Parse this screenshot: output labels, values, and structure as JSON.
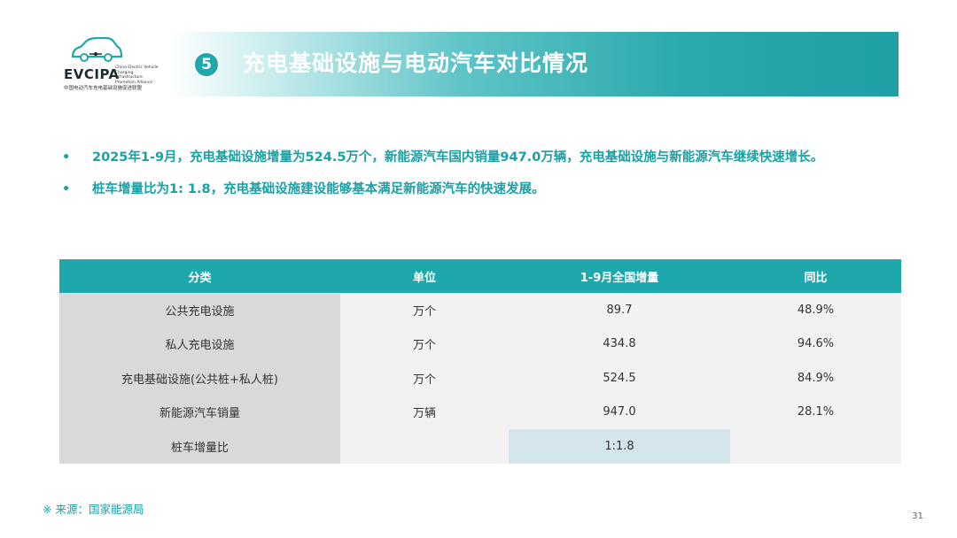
{
  "logo": {
    "brand": "EVCIPA",
    "english_lines": [
      "China Electric Vehicle",
      "Charging Infrastructure",
      "Promotion Alliance"
    ],
    "chinese": "中国电动汽车充电基础设施促进联盟"
  },
  "header": {
    "number": "5",
    "title": "充电基础设施与电动汽车对比情况"
  },
  "bullets": [
    {
      "marker": "•",
      "text": "2025年1-9月，充电基础设施增量为524.5万个，新能源汽车国内销量947.0万辆，充电基础设施与新能源汽车继续快速增长。"
    },
    {
      "marker": "•",
      "text": "桩车增量比为1: 1.8，充电基础设施建设能够基本满足新能源汽车的快速发展。"
    }
  ],
  "table": {
    "headers": [
      "分类",
      "单位",
      "1-9月全国增量",
      "同比"
    ],
    "rows": [
      [
        "公共充电设施",
        "万个",
        "89.7",
        "48.9%"
      ],
      [
        "私人充电设施",
        "万个",
        "434.8",
        "94.6%"
      ],
      [
        "充电基础设施(公共桩+私人桩)",
        "万个",
        "524.5",
        "84.9%"
      ],
      [
        "新能源汽车销量",
        "万辆",
        "947.0",
        "28.1%"
      ],
      [
        "桩车增量比",
        "",
        "1:1.8",
        ""
      ]
    ]
  },
  "footer": {
    "source": "※ 来源：国家能源局",
    "page_number": "31"
  },
  "colors": {
    "accent": "#1fa8ac",
    "text_accent": "#1aa0a5",
    "category_bg": "#d9d9d9",
    "row_bg": "#f2f2f2",
    "highlight_bg": "#d4e6ec"
  }
}
